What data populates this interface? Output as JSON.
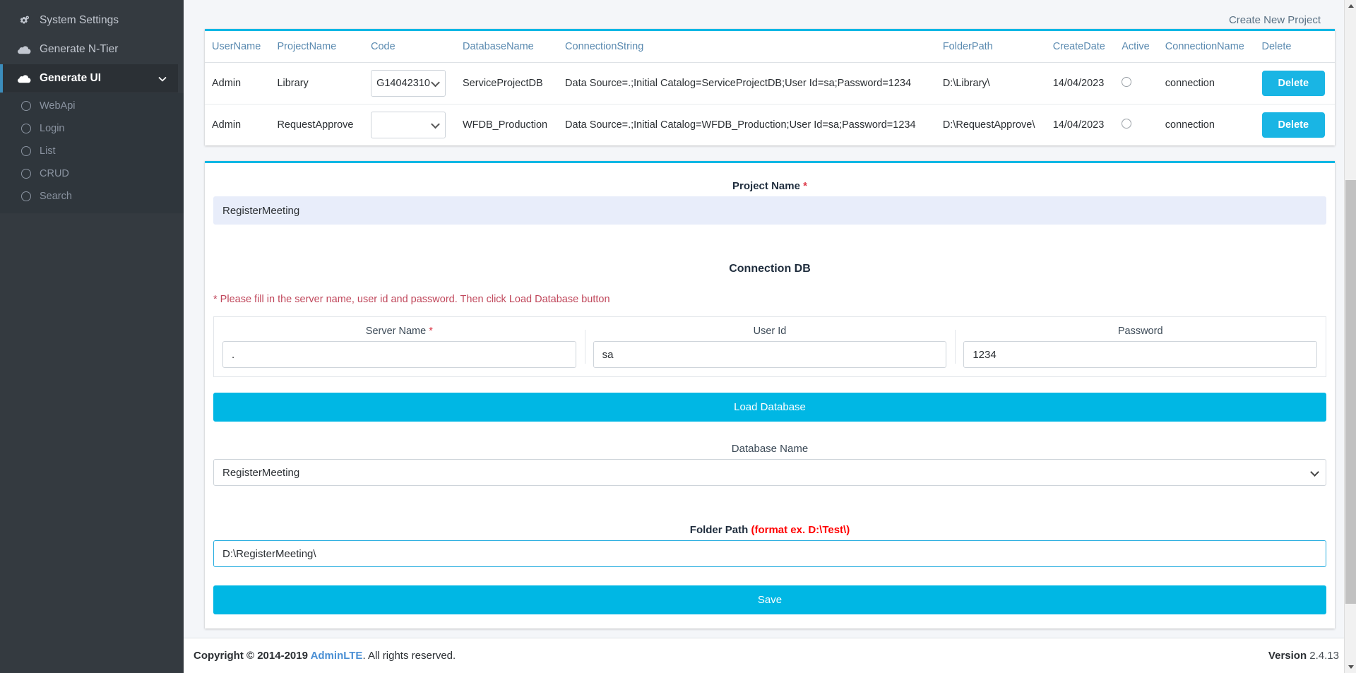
{
  "sidebar": {
    "items": [
      {
        "label": "System Settings",
        "icon": "gears-icon",
        "active": false
      },
      {
        "label": "Generate N-Tier",
        "icon": "cloud-icon",
        "active": false
      },
      {
        "label": "Generate UI",
        "icon": "cloud-icon",
        "active": true,
        "chevron": "⌄"
      }
    ],
    "submenu": [
      {
        "label": "WebApi",
        "icon": "circle-icon"
      },
      {
        "label": "Login",
        "icon": "circle-icon"
      },
      {
        "label": "List",
        "icon": "circle-icon"
      },
      {
        "label": "CRUD",
        "icon": "circle-icon"
      },
      {
        "label": "Search",
        "icon": "circle-icon"
      }
    ]
  },
  "header": {
    "create_new_project": "Create New Project"
  },
  "projects_table": {
    "columns": [
      "UserName",
      "ProjectName",
      "Code",
      "DatabaseName",
      "ConnectionString",
      "FolderPath",
      "CreateDate",
      "Active",
      "ConnectionName",
      "Delete"
    ],
    "rows": [
      {
        "username": "Admin",
        "project_name": "Library",
        "code": "G14042310",
        "database_name": "ServiceProjectDB",
        "connection_string": "Data Source=.;Initial Catalog=ServiceProjectDB;User Id=sa;Password=1234",
        "folder_path": "D:\\Library\\",
        "create_date": "14/04/2023",
        "active": false,
        "connection_name": "connection",
        "delete_label": "Delete"
      },
      {
        "username": "Admin",
        "project_name": "RequestApprove",
        "code": "",
        "database_name": "WFDB_Production",
        "connection_string": "Data Source=.;Initial Catalog=WFDB_Production;User Id=sa;Password=1234",
        "folder_path": "D:\\RequestApprove\\",
        "create_date": "14/04/2023",
        "active": false,
        "connection_name": "connection",
        "delete_label": "Delete"
      }
    ]
  },
  "form": {
    "project_name_label": "Project Name ",
    "project_name_required": "*",
    "project_name_value": "RegisterMeeting",
    "connection_db_heading": "Connection DB",
    "note": "* Please fill in the server name, user id and password. Then click Load Database button",
    "server_name_label": "Server Name ",
    "server_name_required": "*",
    "server_name_value": ".",
    "user_id_label": "User Id",
    "user_id_value": "sa",
    "password_label": "Password",
    "password_value": "1234",
    "load_database_label": "Load Database",
    "database_name_label": "Database Name",
    "database_name_value": "RegisterMeeting",
    "folder_path_label": "Folder Path ",
    "folder_path_format": "(format ex. D:\\Test\\)",
    "folder_path_value": "D:\\RegisterMeeting\\",
    "save_label": "Save"
  },
  "footer": {
    "copyright_prefix": "Copyright © 2014-2019 ",
    "brand": "AdminLTE",
    "copyright_suffix": ". All rights reserved.",
    "version_label": "Version ",
    "version_number": "2.4.13"
  },
  "colors": {
    "accent": "#00b7e4",
    "sidebar_bg": "#343a40",
    "active_bar": "#3c8dbc",
    "required_red": "#dc3545",
    "note_red": "#c0475b",
    "brand_link": "#4a8fd4"
  }
}
